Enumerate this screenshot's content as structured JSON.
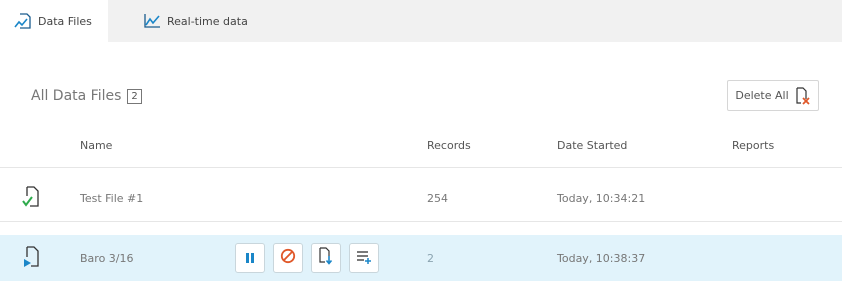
{
  "tabs": [
    {
      "label": "Data Files",
      "icon": "data-files-icon",
      "active": true
    },
    {
      "label": "Real-time data",
      "icon": "realtime-chart-icon",
      "active": false
    }
  ],
  "section": {
    "title": "All Data Files",
    "count": "2"
  },
  "delete_all": {
    "label": "Delete All",
    "icon": "delete-file-icon"
  },
  "columns": {
    "name": "Name",
    "records": "Records",
    "date_started": "Date Started",
    "reports": "Reports"
  },
  "rows": [
    {
      "name": "Test File #1",
      "records": "254",
      "date_started": "Today, 10:34:21",
      "status_icon": "file-complete-icon",
      "selected": false
    },
    {
      "name": "Baro 3/16",
      "records": "2",
      "date_started": "Today, 10:38:37",
      "status_icon": "file-recording-icon",
      "selected": true
    }
  ],
  "row_actions": [
    "pause-icon",
    "stop-icon",
    "download-file-icon",
    "add-list-icon"
  ],
  "colors": {
    "accent": "#1a86c8",
    "success": "#2eaa4c",
    "danger": "#e0582a",
    "selected_row": "#e1f3fb",
    "tabbar": "#f1f1f1"
  }
}
